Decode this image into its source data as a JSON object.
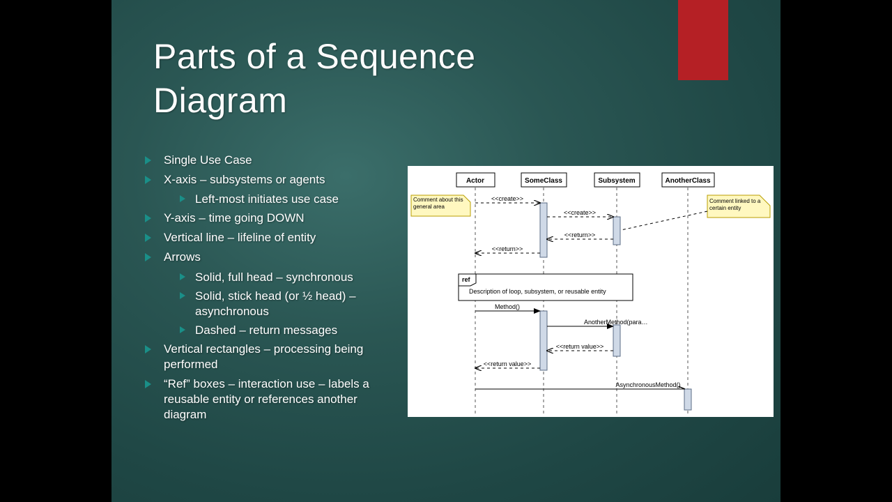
{
  "title_line1": "Parts of a Sequence",
  "title_line2": "Diagram",
  "bullets": {
    "b1": "Single Use Case",
    "b2": "X-axis – subsystems or agents",
    "b2a": "Left-most initiates use case",
    "b3": "Y-axis – time going DOWN",
    "b4": "Vertical line – lifeline of entity",
    "b5": "Arrows",
    "b5a": "Solid, full head – synchronous",
    "b5b": "Solid, stick head (or ½ head) – asynchronous",
    "b5c": "Dashed – return messages",
    "b6": "Vertical rectangles – processing being performed",
    "b7": "“Ref” boxes – interaction use – labels a reusable entity or references another diagram"
  },
  "diagram": {
    "participants": [
      "Actor",
      "SomeClass",
      "Subsystem",
      "AnotherClass"
    ],
    "comment_left": "Comment about this general area",
    "comment_right": "Comment linked to a certain entity",
    "msg_create1": "<<create>>",
    "msg_create2": "<<create>>",
    "msg_return1": "<<return>>",
    "msg_return2": "<<return>>",
    "ref_label": "ref",
    "ref_body": "Description of loop, subsystem, or reusable entity",
    "msg_method": "Method()",
    "msg_another": "AnotherMethod(para…",
    "msg_retval1": "<<return value>>",
    "msg_retval2": "<<return value>>",
    "msg_async": "AsynchronousMethod()"
  }
}
